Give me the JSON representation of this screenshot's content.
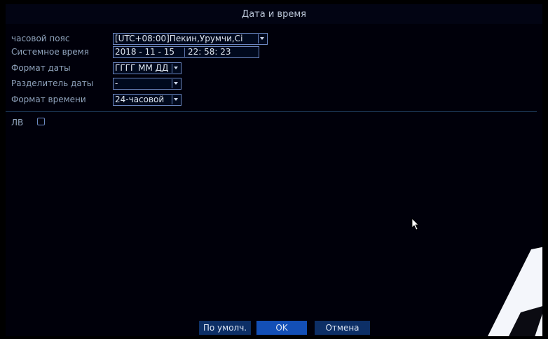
{
  "window": {
    "title": "Дата и время"
  },
  "fields": {
    "timezone": {
      "label": "часовой пояс",
      "value": "[UTC+08:00]Пекин,Урумчи,Сi"
    },
    "system_time": {
      "label": "Системное время",
      "date": "2018 - 11 - 15",
      "time": "22: 58: 23"
    },
    "date_format": {
      "label": "Формат даты",
      "value": "ГГГГ ММ ДД"
    },
    "date_separator": {
      "label": "Разделитель даты",
      "value": "-"
    },
    "time_format": {
      "label": "Формат времени",
      "value": "24-часовой"
    }
  },
  "dst": {
    "label": "ЛВ",
    "checked": false
  },
  "buttons": {
    "default": "По умолч.",
    "ok": "OK",
    "cancel": "Отмена"
  },
  "colors": {
    "accent": "#134fb6",
    "field_border": "#6b88c4",
    "label": "#8fa3bd",
    "background": "#00000a"
  },
  "icons": {
    "dropdown": "chevron-down-icon",
    "pointer": "mouse-pointer-icon"
  }
}
